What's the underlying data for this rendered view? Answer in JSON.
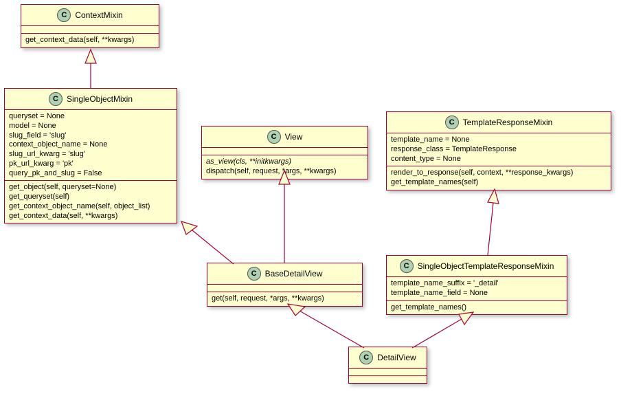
{
  "classes": {
    "ContextMixin": {
      "name": "ContextMixin",
      "attrs": [],
      "methods": [
        "get_context_data(self, **kwargs)"
      ]
    },
    "SingleObjectMixin": {
      "name": "SingleObjectMixin",
      "attrs": [
        "queryset = None",
        "model = None",
        "slug_field = 'slug'",
        "context_object_name = None",
        "slug_url_kwarg = 'slug'",
        "pk_url_kwarg = 'pk'",
        "query_pk_and_slug = False"
      ],
      "methods": [
        "get_object(self, queryset=None)",
        "get_queryset(self)",
        "get_context_object_name(self, object_list)",
        "get_context_data(self, **kwargs)"
      ]
    },
    "View": {
      "name": "View",
      "attrs": [],
      "methods_italic": [
        "as_view(cls, **initkwargs)"
      ],
      "methods": [
        "dispatch(self, request, *args, **kwargs)"
      ]
    },
    "TemplateResponseMixin": {
      "name": "TemplateResponseMixin",
      "attrs": [
        "template_name = None",
        "response_class = TemplateResponse",
        "content_type = None"
      ],
      "methods": [
        "render_to_response(self, context, **response_kwargs)",
        "get_template_names(self)"
      ]
    },
    "BaseDetailView": {
      "name": "BaseDetailView",
      "attrs": [],
      "methods": [
        "get(self, request, *args, **kwargs)"
      ]
    },
    "SingleObjectTemplateResponseMixin": {
      "name": "SingleObjectTemplateResponseMixin",
      "attrs": [
        "template_name_suffix = '_detail'",
        "template_name_field = None"
      ],
      "methods": [
        "get_template_names()"
      ]
    },
    "DetailView": {
      "name": "DetailView",
      "attrs": [],
      "methods": []
    }
  }
}
